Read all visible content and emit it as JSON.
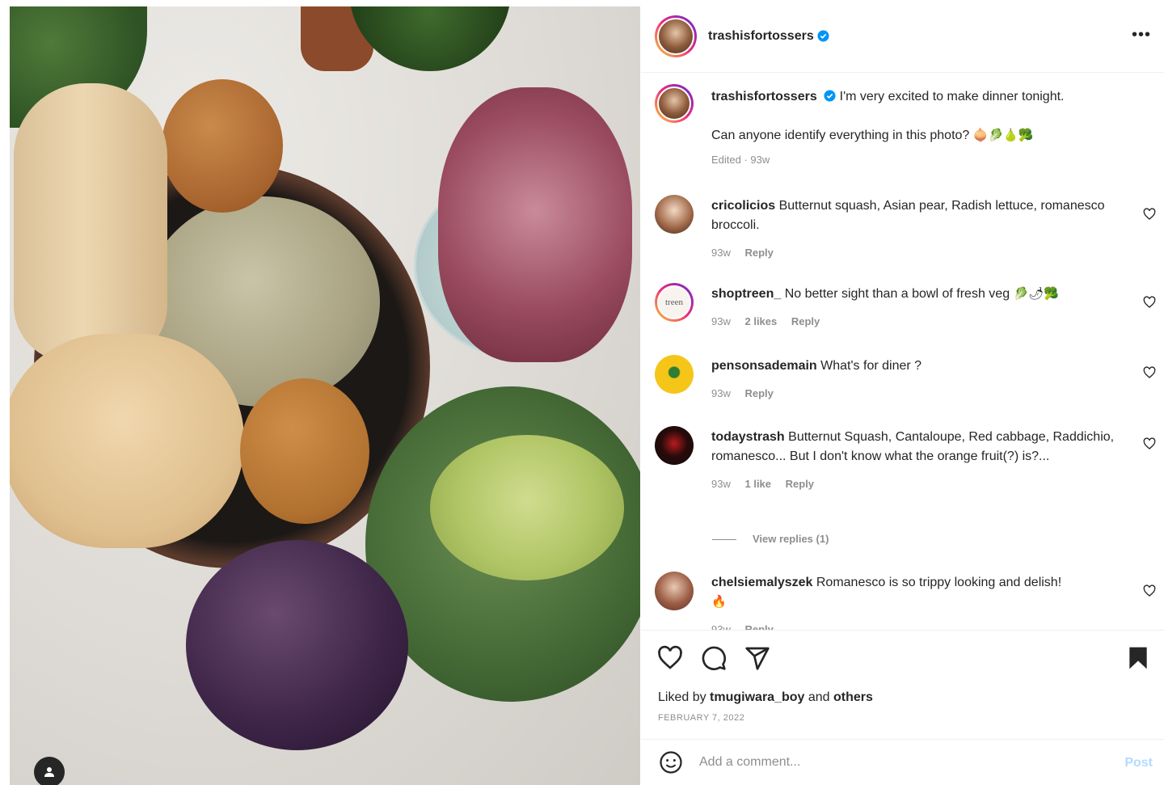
{
  "post": {
    "author": "trashisfortossers",
    "verified": true
  },
  "caption": {
    "username": "trashisfortossers",
    "line1": "I'm very excited to make dinner tonight.",
    "line2": "Can anyone identify everything in this photo?",
    "emojis": "🧅🥬🍐🥦",
    "edited": "Edited · 93w"
  },
  "comments": [
    {
      "username": "cricolicios",
      "text": "Butternut squash, Asian pear, Radish lettuce, romanesco broccoli.",
      "time": "93w",
      "likes": "",
      "reply": "Reply"
    },
    {
      "username": "shoptreen_",
      "text": "No better sight than a bowl of fresh veg",
      "emojis": "🥬🌶🥦",
      "time": "93w",
      "likes": "2 likes",
      "reply": "Reply",
      "avatar_text": "treen"
    },
    {
      "username": "pensonsademain",
      "text": "What's for diner ?",
      "time": "93w",
      "likes": "",
      "reply": "Reply"
    },
    {
      "username": "todaystrash",
      "text": "Butternut Squash, Cantaloupe, Red cabbage, Raddichio, romanesco... But I don't know what the orange fruit(?) is?...",
      "time": "93w",
      "likes": "1 like",
      "reply": "Reply",
      "view_replies": "View replies (1)"
    },
    {
      "username": "chelsiemalyszek",
      "text": "Romanesco is so trippy looking and delish!",
      "emojis": "🔥",
      "time": "93w",
      "likes": "",
      "reply": "Reply"
    }
  ],
  "engagement": {
    "liked_prefix": "Liked by",
    "liked_user": "tmugiwara_boy",
    "liked_and": "and",
    "liked_others": "others",
    "date": "February 7, 2022"
  },
  "composer": {
    "placeholder": "Add a comment...",
    "post_label": "Post"
  },
  "icons": {
    "more": "more-horizontal-icon",
    "like": "heart-icon",
    "comment": "comment-bubble-icon",
    "share": "paper-plane-icon",
    "save": "bookmark-filled-icon",
    "emoji": "smiley-icon",
    "tag": "user-tag-icon"
  },
  "colors": {
    "verified_blue": "#0095f6",
    "post_disabled": "#b3dbff",
    "muted": "#8e8e8e",
    "text": "#262626"
  }
}
